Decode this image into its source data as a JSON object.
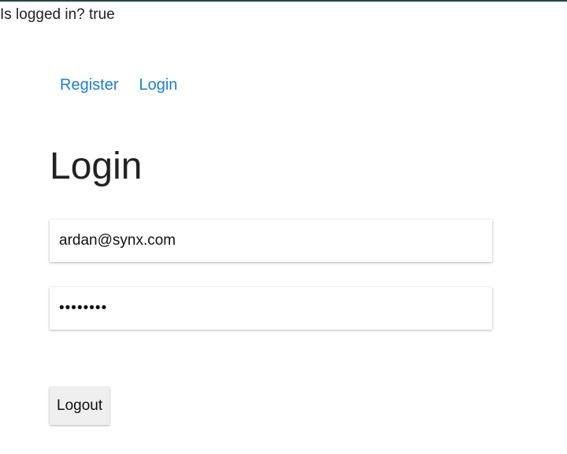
{
  "status": {
    "text": "Is logged in? true"
  },
  "nav": {
    "items": [
      {
        "label": "Register"
      },
      {
        "label": "Login"
      }
    ]
  },
  "main": {
    "title": "Login",
    "email_value": "ardan@synx.com",
    "password_value": "********",
    "logout_label": "Logout"
  },
  "colors": {
    "link": "#1a7fd4",
    "top_border": "#1f4a44",
    "button_bg": "#efefef"
  }
}
